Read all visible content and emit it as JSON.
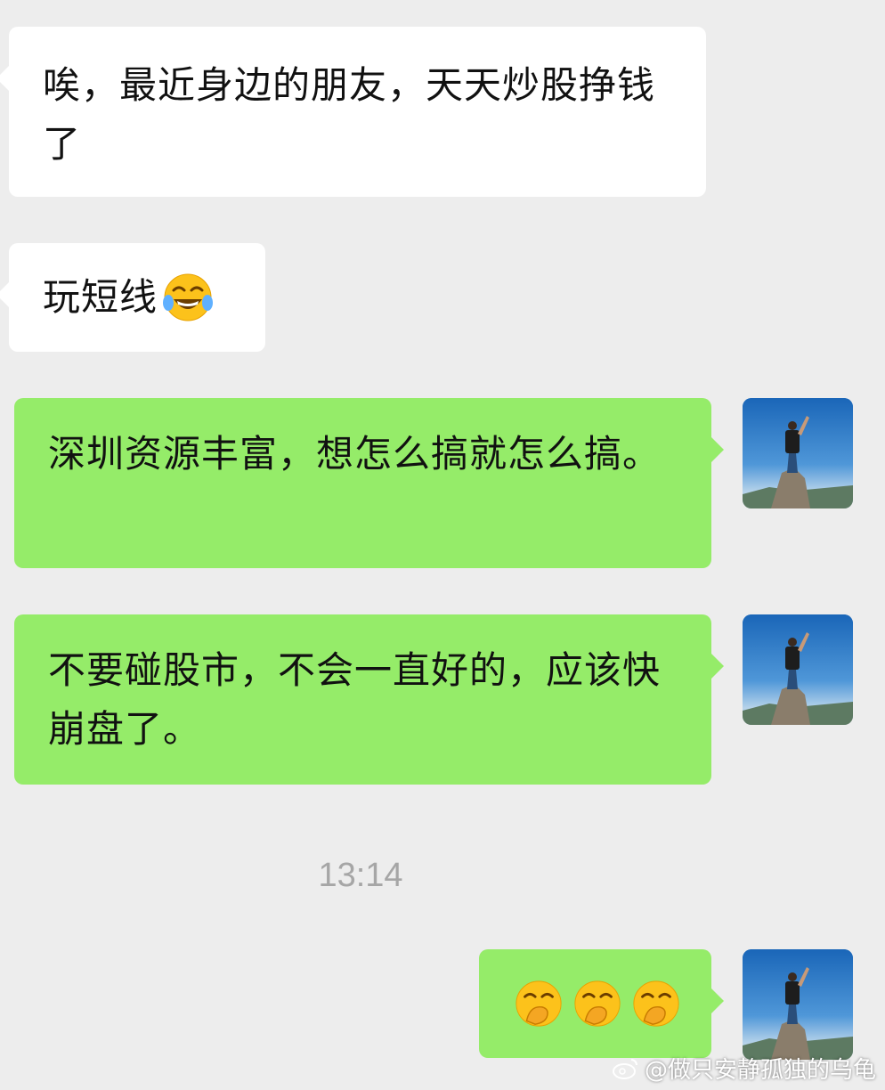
{
  "messages": [
    {
      "side": "in",
      "text": "唉，最近身边的朋友，天天炒股挣钱了"
    },
    {
      "side": "in",
      "text": "玩短线",
      "emoji": "face-with-tears-of-joy"
    },
    {
      "side": "out",
      "text": "深圳资源丰富，想怎么搞就怎么搞。"
    },
    {
      "side": "out",
      "text": "不要碰股市，不会一直好的，应该快崩盘了。"
    },
    {
      "side": "out",
      "emoji": [
        "hand-over-mouth-face",
        "hand-over-mouth-face",
        "hand-over-mouth-face"
      ]
    }
  ],
  "timestamp": "13:14",
  "watermark": "@做只安静孤独的乌龟",
  "colors": {
    "background": "#ededed",
    "incoming_bubble": "#ffffff",
    "outgoing_bubble": "#95ec69",
    "timestamp": "#a6a6a6"
  }
}
